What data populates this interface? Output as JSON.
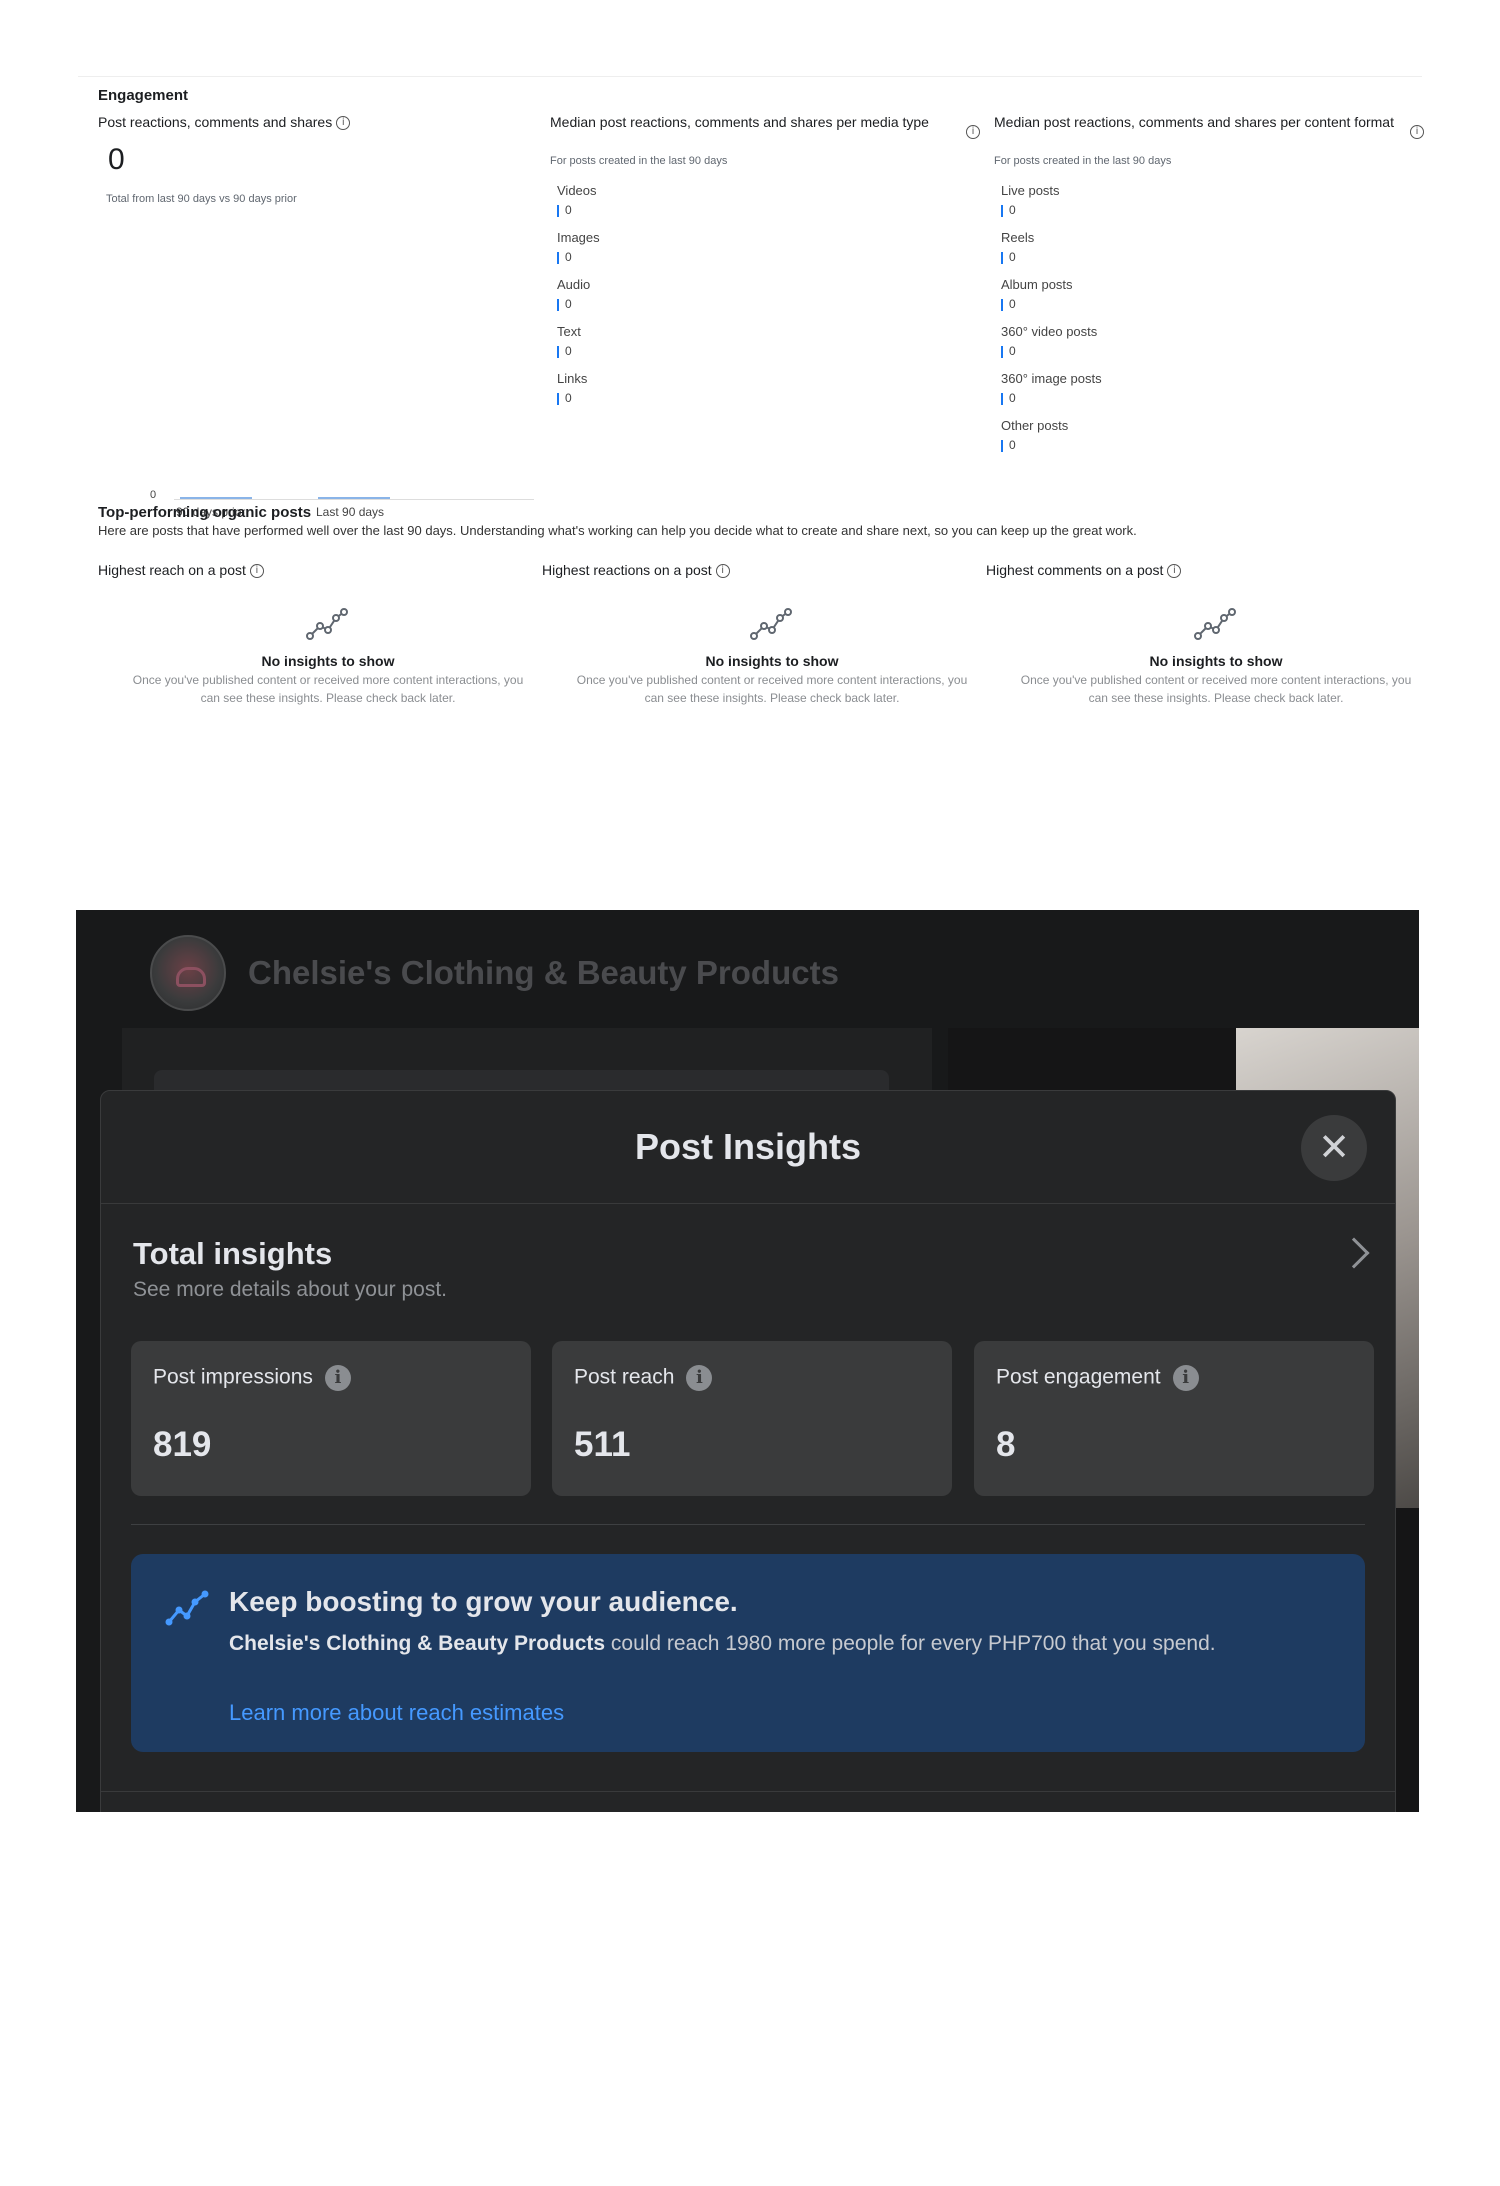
{
  "engagement": {
    "section_title": "Engagement",
    "col1": {
      "title": "Post reactions, comments and shares",
      "value": "0",
      "subtitle": "Total from last 90 days vs 90 days prior",
      "chart_zero": "0",
      "x_labels": [
        "90 days prior",
        "Last 90 days"
      ]
    },
    "col2": {
      "title": "Median post reactions, comments and shares per media type",
      "subtitle": "For posts created in the last 90 days",
      "items": [
        {
          "label": "Videos",
          "value": "0"
        },
        {
          "label": "Images",
          "value": "0"
        },
        {
          "label": "Audio",
          "value": "0"
        },
        {
          "label": "Text",
          "value": "0"
        },
        {
          "label": "Links",
          "value": "0"
        }
      ]
    },
    "col3": {
      "title": "Median post reactions, comments and shares per content format",
      "subtitle": "For posts created in the last 90 days",
      "items": [
        {
          "label": "Live posts",
          "value": "0"
        },
        {
          "label": "Reels",
          "value": "0"
        },
        {
          "label": "Album posts",
          "value": "0"
        },
        {
          "label": "360° video posts",
          "value": "0"
        },
        {
          "label": "360° image posts",
          "value": "0"
        },
        {
          "label": "Other posts",
          "value": "0"
        }
      ]
    }
  },
  "top_posts": {
    "title": "Top-performing organic posts",
    "description": "Here are posts that have performed well over the last 90 days. Understanding what's working can help you decide what to create and share next, so you can keep up the great work.",
    "cards": [
      {
        "head": "Highest reach on a post",
        "empty_title": "No insights to show",
        "empty_desc": "Once you've published content or received more content interactions, you can see these insights. Please check back later."
      },
      {
        "head": "Highest reactions on a post",
        "empty_title": "No insights to show",
        "empty_desc": "Once you've published content or received more content interactions, you can see these insights. Please check back later."
      },
      {
        "head": "Highest comments on a post",
        "empty_title": "No insights to show",
        "empty_desc": "Once you've published content or received more content interactions, you can see these insights. Please check back later."
      }
    ]
  },
  "dialog": {
    "page_name": "Chelsie's Clothing & Beauty Products",
    "title": "Post Insights",
    "total_title": "Total insights",
    "total_sub": "See more details about your post.",
    "stats": [
      {
        "label": "Post impressions",
        "value": "819"
      },
      {
        "label": "Post reach",
        "value": "511"
      },
      {
        "label": "Post engagement",
        "value": "8"
      }
    ],
    "boost": {
      "title": "Keep boosting to grow your audience.",
      "page_name": "Chelsie's Clothing & Beauty Products",
      "body_rest": " could reach 1980 more people for every PHP700 that you spend.",
      "link": "Learn more about reach estimates"
    }
  },
  "colors": {
    "accent": "#1877f2",
    "dark_bg": "#18191a",
    "modal_bg": "#242526",
    "boost_bg": "#1e3b61",
    "link": "#4599ff"
  }
}
